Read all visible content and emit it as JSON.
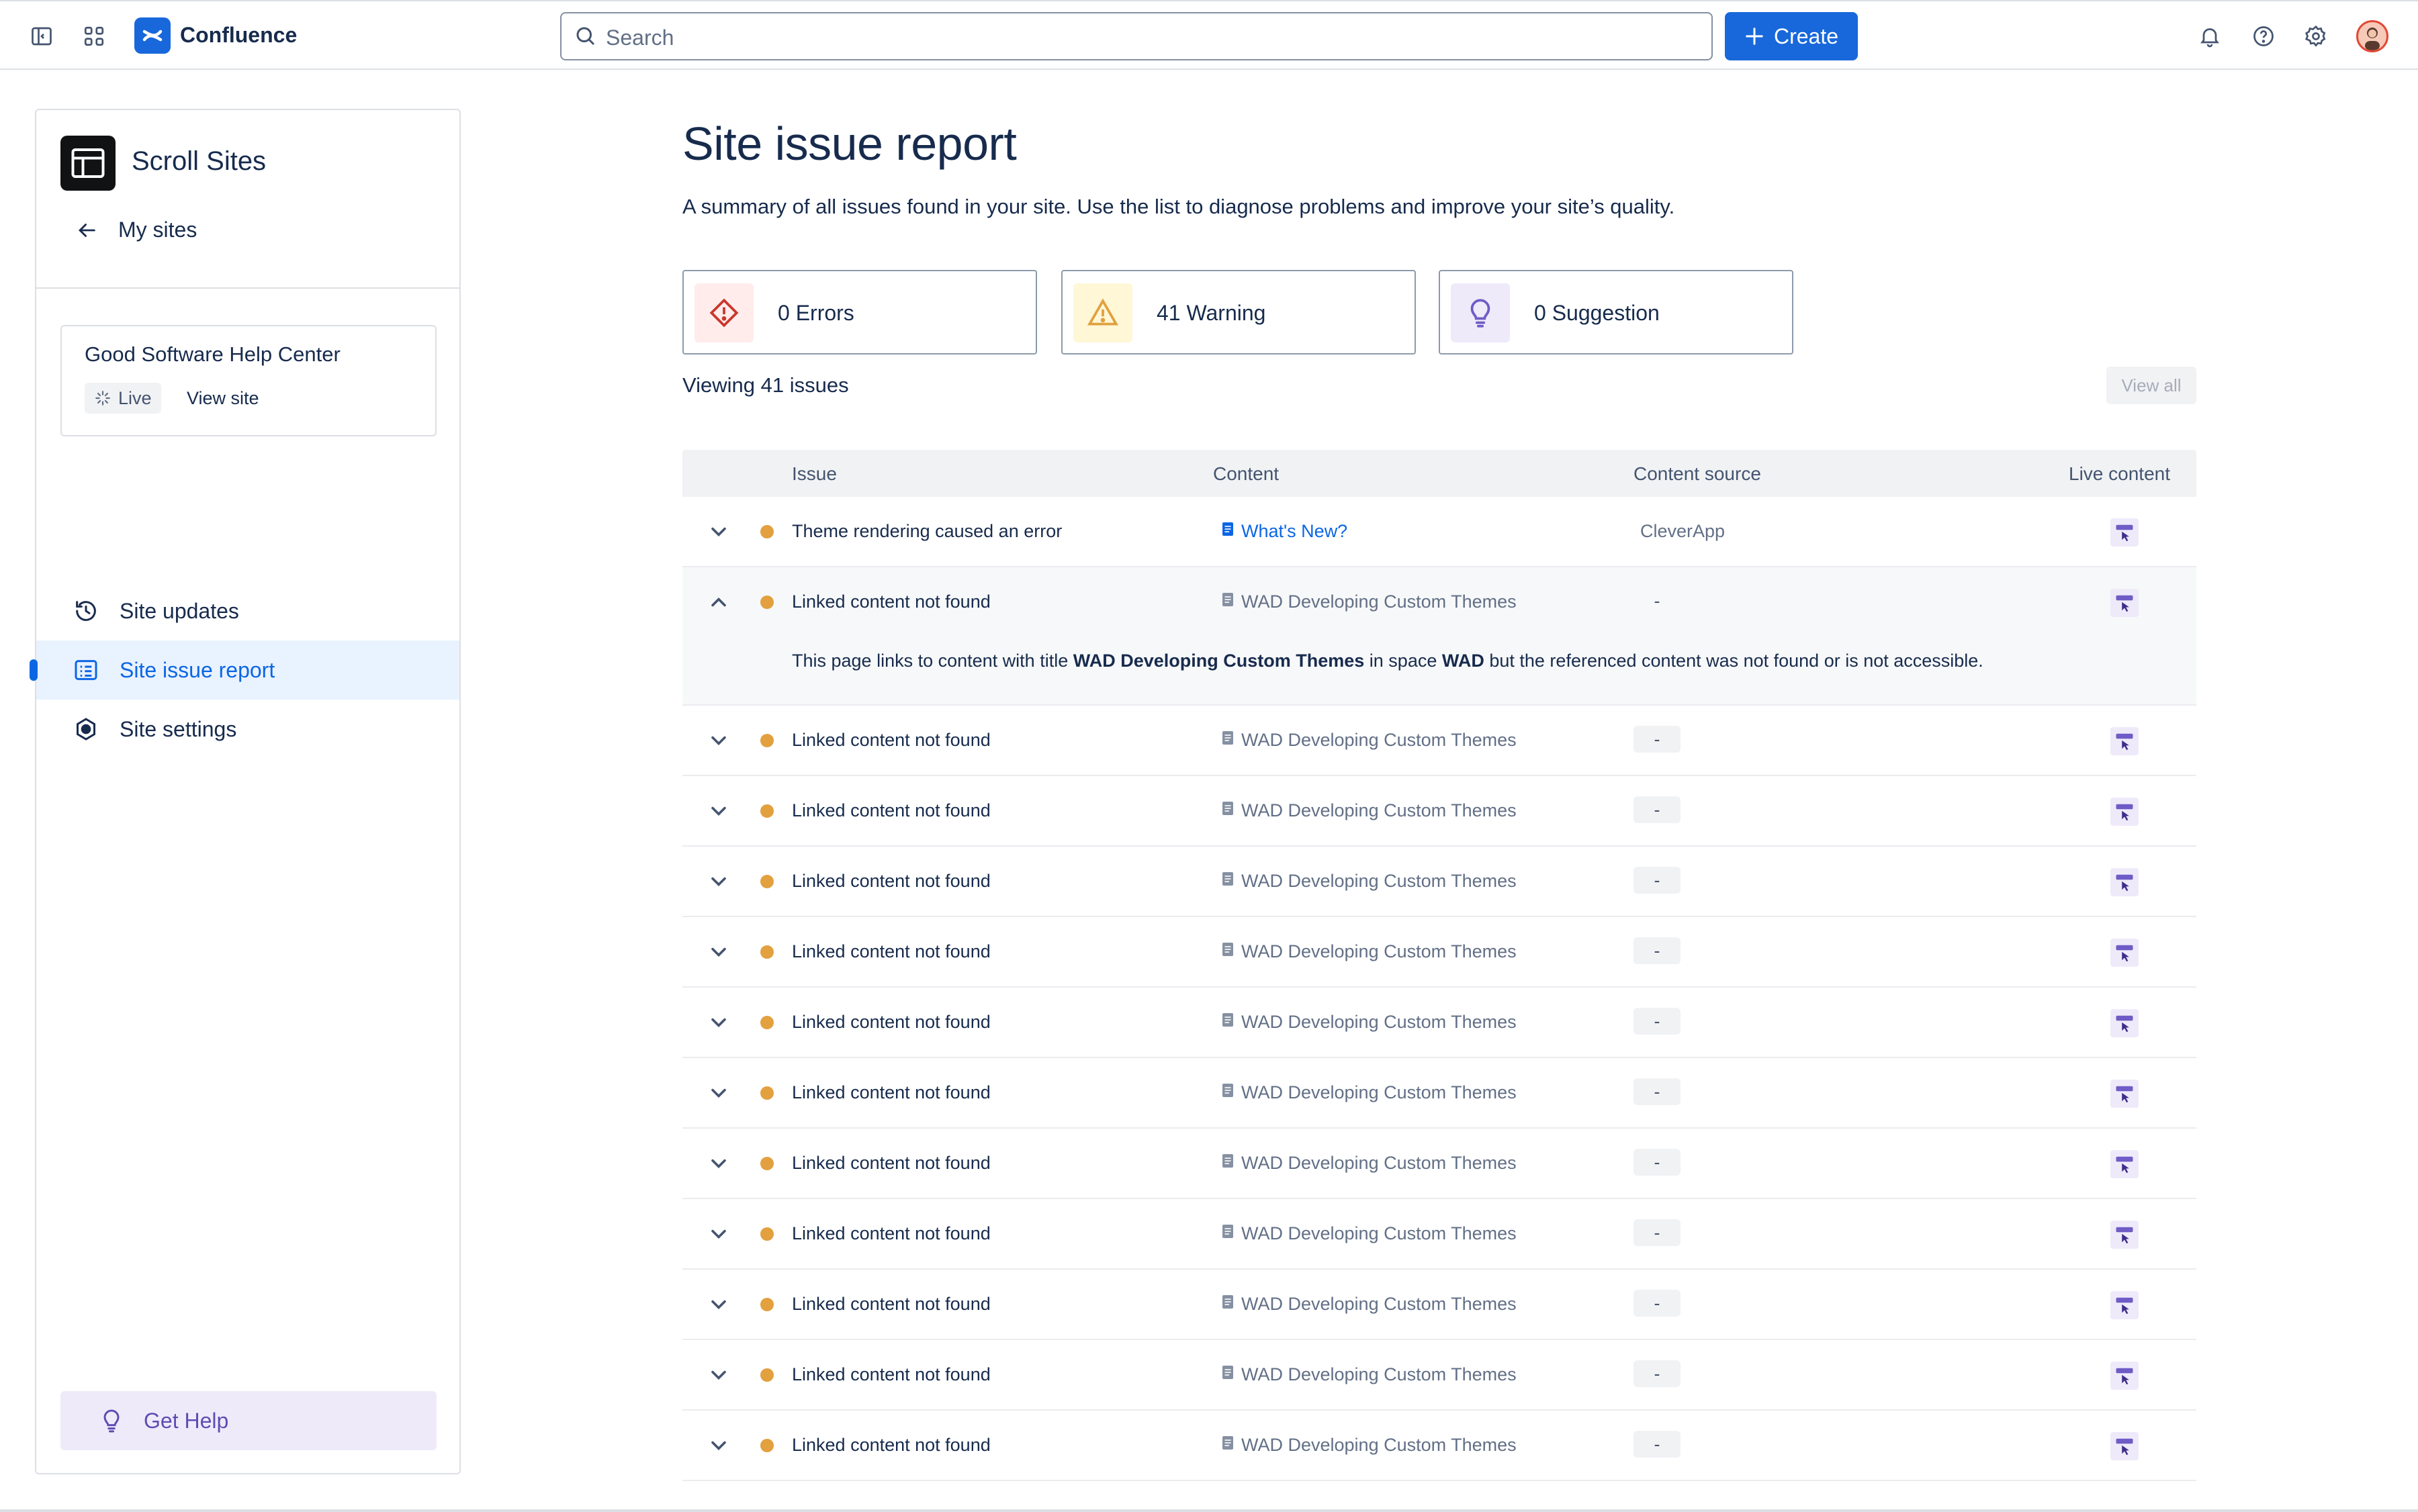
{
  "topbar": {
    "brand": "Confluence",
    "search_placeholder": "Search",
    "create_label": "Create"
  },
  "sidebar": {
    "title": "Scroll Sites",
    "back_label": "My sites",
    "site": {
      "name": "Good Software Help Center",
      "status": "Live",
      "view_label": "View site"
    },
    "items": [
      {
        "label": "Site updates",
        "icon": "history-icon",
        "active": false
      },
      {
        "label": "Site issue report",
        "icon": "list-icon",
        "active": true
      },
      {
        "label": "Site settings",
        "icon": "settings-icon",
        "active": false
      }
    ],
    "help_label": "Get Help"
  },
  "main": {
    "title": "Site issue report",
    "subtitle": "A summary of all issues found in your site. Use the list to diagnose problems and improve your site’s quality.",
    "stats": {
      "errors": "0 Errors",
      "warnings": "41 Warning",
      "suggestions": "0 Suggestion"
    },
    "viewing": "Viewing 41 issues",
    "view_all": "View all",
    "colors": {
      "accent": "#1868db",
      "warning_dot": "#e2a03f",
      "error": "#c9372c",
      "warning": "#e2a03f",
      "suggestion": "#6e5dc6"
    }
  },
  "table": {
    "headers": {
      "issue": "Issue",
      "content": "Content",
      "source": "Content source",
      "live": "Live content"
    },
    "rows": [
      {
        "issue": "Theme rendering caused an error",
        "content": "What's New?",
        "source": "CleverApp"
      },
      {
        "issue": "Linked content not found",
        "content": "WAD Developing Custom Themes",
        "source": "-"
      },
      {
        "issue": "Linked content not found",
        "content": "WAD Developing Custom Themes",
        "source": "-"
      },
      {
        "issue": "Linked content not found",
        "content": "WAD Developing Custom Themes",
        "source": "-"
      },
      {
        "issue": "Linked content not found",
        "content": "WAD Developing Custom Themes",
        "source": "-"
      },
      {
        "issue": "Linked content not found",
        "content": "WAD Developing Custom Themes",
        "source": "-"
      },
      {
        "issue": "Linked content not found",
        "content": "WAD Developing Custom Themes",
        "source": "-"
      },
      {
        "issue": "Linked content not found",
        "content": "WAD Developing Custom Themes",
        "source": "-"
      },
      {
        "issue": "Linked content not found",
        "content": "WAD Developing Custom Themes",
        "source": "-"
      },
      {
        "issue": "Linked content not found",
        "content": "WAD Developing Custom Themes",
        "source": "-"
      },
      {
        "issue": "Linked content not found",
        "content": "WAD Developing Custom Themes",
        "source": "-"
      },
      {
        "issue": "Linked content not found",
        "content": "WAD Developing Custom Themes",
        "source": "-"
      },
      {
        "issue": "Linked content not found",
        "content": "WAD Developing Custom Themes",
        "source": "-"
      }
    ],
    "expanded_detail": {
      "prefix": "This page links to content with title ",
      "title": "WAD Developing Custom Themes",
      "middle": " in space ",
      "space": "WAD",
      "suffix": " but the referenced content was not found or is not accessible."
    }
  }
}
